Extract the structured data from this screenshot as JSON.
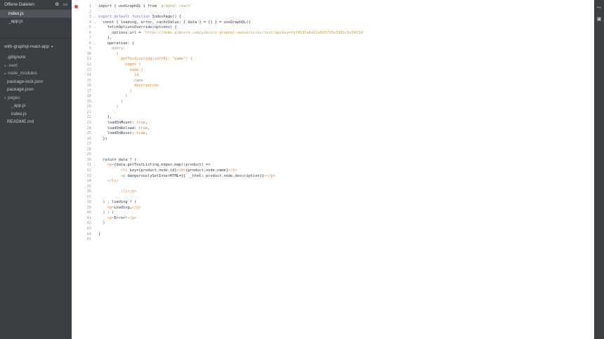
{
  "sidebar": {
    "open_files_title": "Offene Dateien",
    "open_files": [
      {
        "name": "index.js",
        "active": true
      },
      {
        "name": "_app.js",
        "active": false
      }
    ],
    "project_name": "with-graphql-react-app",
    "tree": [
      {
        "name": ".gitignore",
        "type": "file",
        "indent": 1
      },
      {
        "name": ".next",
        "type": "folder",
        "indent": 0
      },
      {
        "name": "node_modules",
        "type": "folder",
        "indent": 0
      },
      {
        "name": "package-lock.json",
        "type": "file",
        "indent": 1
      },
      {
        "name": "package.json",
        "type": "file",
        "indent": 1
      },
      {
        "name": "pages",
        "type": "folder-open",
        "indent": 0
      },
      {
        "name": "_app.js",
        "type": "file",
        "indent": 2
      },
      {
        "name": "index.js",
        "type": "file",
        "indent": 2
      },
      {
        "name": "README.md",
        "type": "file",
        "indent": 1
      }
    ]
  },
  "editor": {
    "error_line": 1,
    "fold_lines": [
      3,
      4,
      5,
      8,
      31
    ],
    "lines": [
      [
        [
          "import { useGraphQL } from ",
          "b"
        ],
        [
          "'graphql-react'",
          "s"
        ]
      ],
      [],
      [
        [
          "export default function ",
          "k"
        ],
        [
          "IndexPage() {",
          "b"
        ]
      ],
      [
        [
          "  const { loading, error, cacheValue: { data } = {} } = useGraphQL({",
          "b"
        ]
      ],
      [
        [
          "    fetchOptionsOverride(options) {",
          "b"
        ]
      ],
      [
        [
          "      options.url = ",
          "b"
        ],
        [
          "'https://demo.pimcore.com/pimcore-graphql-webservices/test?apikey=fef013fa6d22e695755e3301c5e5453d'",
          "s"
        ]
      ],
      [
        [
          "    },",
          "b"
        ]
      ],
      [
        [
          "    operation: {",
          "b"
        ]
      ],
      [
        [
          "      query: `",
          "t"
        ]
      ],
      [
        [
          "        {",
          "t"
        ]
      ],
      [
        [
          "          getTestListing(sortBy: \"name\") {",
          "t"
        ]
      ],
      [
        [
          "            edges {",
          "t"
        ]
      ],
      [
        [
          "              node {",
          "t"
        ]
      ],
      [
        [
          "                id",
          "t"
        ]
      ],
      [
        [
          "                name",
          "t"
        ]
      ],
      [
        [
          "                description",
          "t"
        ]
      ],
      [
        [
          "              }",
          "t"
        ]
      ],
      [
        [
          "            }",
          "t"
        ]
      ],
      [
        [
          "          }",
          "t"
        ]
      ],
      [
        [
          "        }",
          "t"
        ]
      ],
      [
        [
          "      `,",
          "t"
        ]
      ],
      [
        [
          "    },",
          "b"
        ]
      ],
      [
        [
          "    loadOnMount: ",
          "b"
        ],
        [
          "true",
          "n"
        ],
        [
          ",",
          "b"
        ]
      ],
      [
        [
          "    loadOnReload: ",
          "b"
        ],
        [
          "true",
          "n"
        ],
        [
          ",",
          "b"
        ]
      ],
      [
        [
          "    loadOnReset: ",
          "b"
        ],
        [
          "true",
          "n"
        ],
        [
          ",",
          "b"
        ]
      ],
      [
        [
          "  })",
          "b"
        ]
      ],
      [],
      [],
      [],
      [
        [
          "  return data ? (",
          "b"
        ]
      ],
      [
        [
          "    <p>",
          "t"
        ],
        [
          "{data.getTestListing.edges.map((product) =>",
          "b"
        ]
      ],
      [
        [
          "          <li ",
          "t"
        ],
        [
          "key={product.node.id}",
          "b"
        ],
        [
          "><b>",
          "t"
        ],
        [
          "{product.node.name}",
          "b"
        ],
        [
          "</b>",
          "t"
        ]
      ],
      [
        [
          "          <p ",
          "t"
        ],
        [
          "dangerouslySetInnerHTML={{ __html: product.node.description}}",
          "b"
        ],
        [
          "></p>",
          "t"
        ]
      ],
      [
        [
          "    </li>",
          "t"
        ]
      ],
      [],
      [
        [
          "          ",
          "b"
        ],
        [
          "))}</p>",
          "t"
        ]
      ],
      [],
      [
        [
          "  ) : loading ? (",
          "b"
        ]
      ],
      [
        [
          "    <p>",
          "t"
        ],
        [
          "Loading…",
          "b"
        ],
        [
          "</p>",
          "t"
        ]
      ],
      [
        [
          "  ) : (",
          "b"
        ]
      ],
      [
        [
          "    <p>",
          "t"
        ],
        [
          "Error!",
          "b"
        ],
        [
          "</p>",
          "t"
        ]
      ],
      [
        [
          "  )",
          "b"
        ]
      ],
      [],
      [
        [
          "}",
          "b"
        ]
      ],
      []
    ]
  }
}
